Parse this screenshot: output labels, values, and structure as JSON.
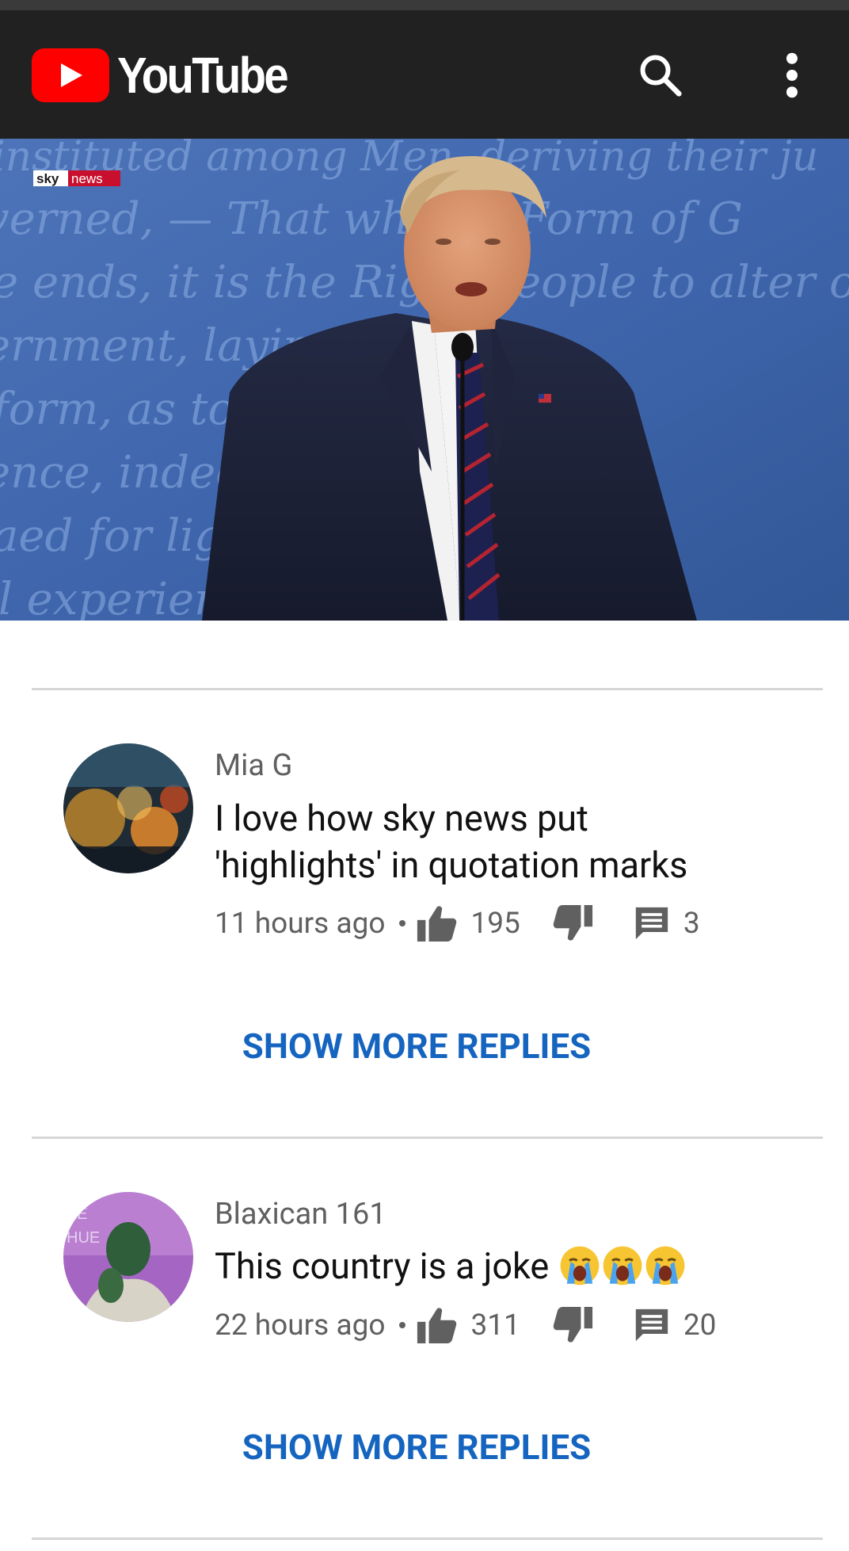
{
  "app": {
    "logo_text": "YouTube",
    "brand_color": "#ff0000"
  },
  "video": {
    "channel_watermark": "sky news"
  },
  "comments": [
    {
      "author": "Mia G",
      "text_line1": "I love how sky news put",
      "text_line2": "'highlights' in quotation marks",
      "time": "11 hours ago",
      "likes": "195",
      "replies": "3",
      "show_more_label": "SHOW MORE REPLIES"
    },
    {
      "author": "Blaxican 161",
      "text": "This country is a joke",
      "emoji": "loudly-crying-face x3",
      "time": "22 hours ago",
      "likes": "311",
      "replies": "20",
      "show_more_label": "SHOW MORE REPLIES"
    }
  ],
  "colors": {
    "link": "#1565c0",
    "meta_text": "#606060",
    "app_bar": "#212121"
  }
}
